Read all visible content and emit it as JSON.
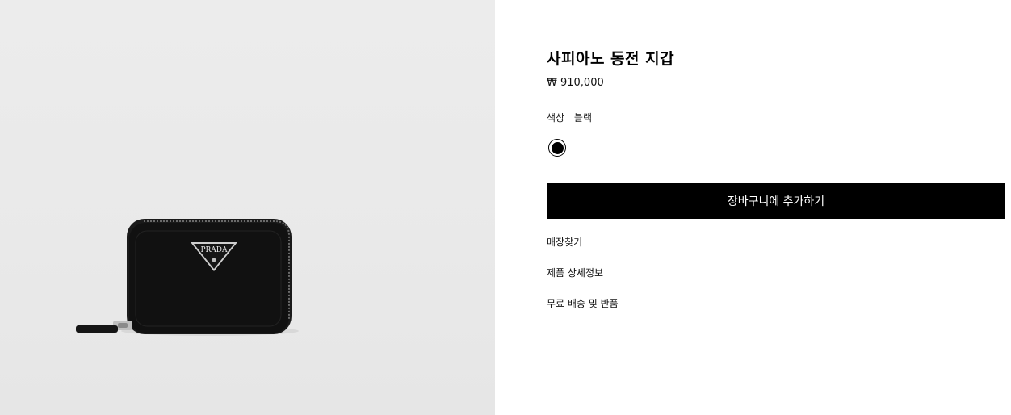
{
  "product": {
    "title": "사피아노 동전 지갑",
    "price": "₩ 910,000",
    "color_label": "색상",
    "color_value": "블랙",
    "swatch_color": "#000000",
    "image_logo_text": "PRADA"
  },
  "actions": {
    "add_to_cart": "장바구니에 추가하기"
  },
  "links": {
    "find_store": "매장찾기",
    "product_details": "제품 상세정보",
    "shipping_returns": "무료 배송 및 반품"
  },
  "colors": {
    "button_bg": "#000000",
    "button_text": "#ffffff",
    "gallery_bg": "#ebebeb"
  }
}
